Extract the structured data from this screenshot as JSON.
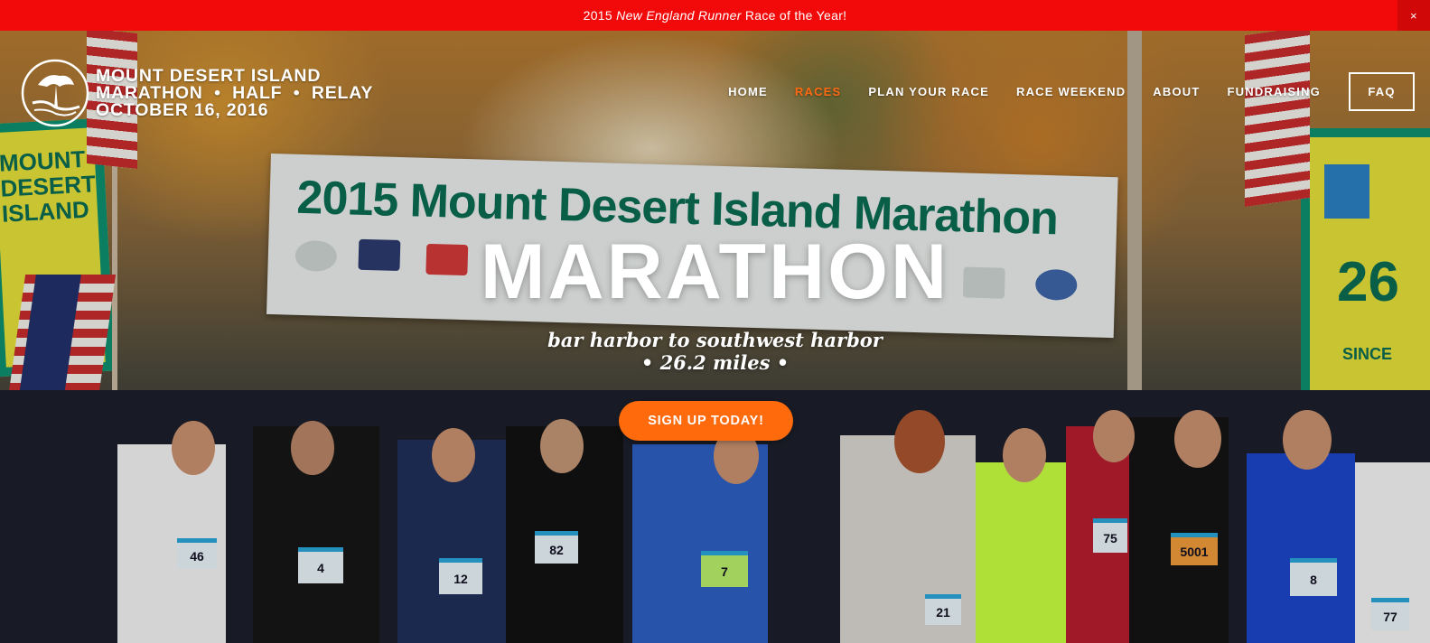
{
  "announcement": {
    "prefix": "2015 ",
    "emphasis": "New England Runner",
    "suffix": " Race of the Year!",
    "close_label": "×"
  },
  "logo": {
    "line1": "MOUNT DESERT ISLAND",
    "line2": "MARATHON  •  HALF  •  RELAY",
    "line3": "OCTOBER 16, 2016"
  },
  "nav": {
    "items": [
      {
        "label": "HOME"
      },
      {
        "label": "RACES"
      },
      {
        "label": "PLAN YOUR RACE"
      },
      {
        "label": "RACE WEEKEND"
      },
      {
        "label": "ABOUT"
      },
      {
        "label": "FUNDRAISING"
      }
    ],
    "faq_label": "FAQ"
  },
  "hero": {
    "title": "MARATHON",
    "subtitle": "bar harbor to southwest harbor",
    "distance": "• 26.2 miles •",
    "cta_label": "SIGN UP TODAY!",
    "banner_text": "2015 Mount Desert Island Marathon",
    "sign_left": "MOUNT DESERT ISLAND",
    "sign_right_year": "26",
    "sign_right_since": "SINCE"
  },
  "bibs": [
    "46",
    "4",
    "12",
    "82",
    "7",
    "21",
    "75",
    "5001",
    "8",
    "77"
  ],
  "colors": {
    "announce_bg": "#f20a0a",
    "accent": "#ff6a0c",
    "nav_active": "#ff6a13",
    "banner_green": "#0b6b52"
  }
}
